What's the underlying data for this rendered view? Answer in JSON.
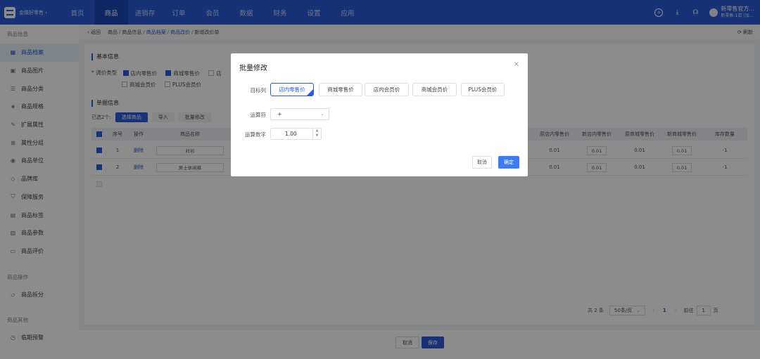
{
  "topbar": {
    "brand_name": "金蝶好零售 ›",
    "nav": [
      "首页",
      "商品",
      "进销存",
      "订单",
      "会员",
      "数据",
      "财务",
      "设置",
      "应用"
    ],
    "active_nav_index": 1,
    "user_name": "新零售官方...",
    "user_store": "新零售-1店 (加...",
    "home_icon": "home-icon",
    "download_icon": "download-icon",
    "headset_icon": "headset-icon"
  },
  "sidebar": {
    "group1": "商品信息",
    "items": [
      {
        "label": "商品档案",
        "icon": "archive-icon"
      },
      {
        "label": "商品图片",
        "icon": "image-icon"
      },
      {
        "label": "商品分类",
        "icon": "list-icon"
      },
      {
        "label": "商品规格",
        "icon": "tag-icon"
      },
      {
        "label": "扩展属性",
        "icon": "edit-icon"
      },
      {
        "label": "属性分组",
        "icon": "grid-icon"
      },
      {
        "label": "商品单位",
        "icon": "unit-icon"
      },
      {
        "label": "品牌库",
        "icon": "brand-icon"
      },
      {
        "label": "保障服务",
        "icon": "shield-icon"
      },
      {
        "label": "商品标签",
        "icon": "label-icon"
      },
      {
        "label": "商品参数",
        "icon": "param-icon"
      },
      {
        "label": "商品评价",
        "icon": "comment-icon"
      }
    ],
    "group2": "商品操作",
    "ops": [
      {
        "label": "商品拆分",
        "icon": "split-icon"
      }
    ],
    "group3": "商品其他",
    "others": [
      {
        "label": "临期预警",
        "icon": "clock-icon"
      }
    ],
    "active_index": 0
  },
  "breadcrumb": {
    "back": "返回",
    "items": [
      "商品",
      "商品信息",
      "商品档案",
      "商品改价",
      "新增改价单"
    ],
    "refresh": "刷新"
  },
  "content": {
    "basic_title": "基本信息",
    "price_type_label": "* 调价类型",
    "price_types": [
      {
        "label": "店内零售价",
        "checked": true
      },
      {
        "label": "商城零售价",
        "checked": true
      },
      {
        "label": "店",
        "checked": false
      },
      {
        "label": "商城会员价",
        "checked": false
      },
      {
        "label": "PLUS会员价",
        "checked": false
      }
    ],
    "detail_title": "单据信息",
    "selected_text": "已选2个:",
    "btn_select": "选择商品",
    "btn_import": "导入",
    "btn_batch": "批量修改",
    "columns": [
      "序号",
      "操作",
      "商品名称",
      "原店内零售价",
      "新店内零售价",
      "原商城零售价",
      "新商城零售价",
      "库存数量"
    ],
    "rows": [
      {
        "no": "1",
        "op": "删除",
        "name": "衬衫",
        "old_store": "0.01",
        "new_store": "0.01",
        "old_mall": "0.01",
        "new_mall": "0.01",
        "stock": "-1"
      },
      {
        "no": "2",
        "op": "删除",
        "name": "男士休闲裤",
        "old_store": "0.01",
        "new_store": "0.01",
        "old_mall": "0.01",
        "new_mall": "0.01",
        "stock": "-1"
      }
    ]
  },
  "pagination": {
    "total": "共 2 条",
    "page_size": "50条/页",
    "current": "1",
    "goto_label": "前往",
    "goto_value": "1",
    "page_suffix": "页"
  },
  "footer": {
    "cancel": "取消",
    "save": "保存"
  },
  "modal": {
    "title": "批量修改",
    "target_label": "目标列",
    "targets": [
      "店内零售价",
      "商城零售价",
      "店内会员价",
      "商城会员价",
      "PLUS会员价"
    ],
    "selected_target_index": 0,
    "operator_label": "运算符",
    "operator_value": "+",
    "number_label": "运算数字",
    "number_value": "1.00",
    "cancel": "取消",
    "confirm": "确定"
  },
  "colors": {
    "primary": "#2b5bd7",
    "topbar": "#2b5bd7"
  }
}
